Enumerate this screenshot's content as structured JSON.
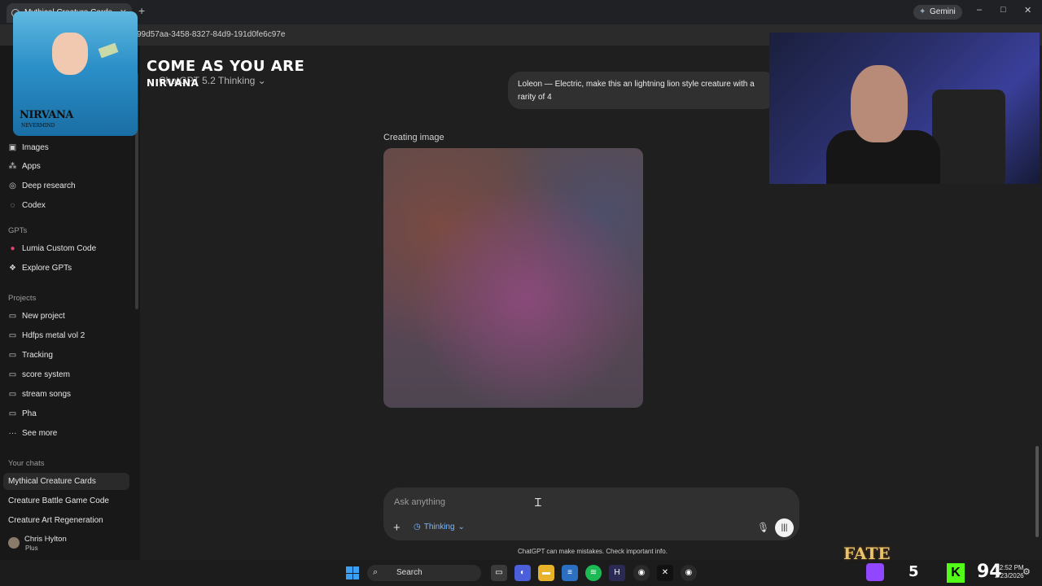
{
  "browser": {
    "tab_title": "Mythical Creature Cards",
    "new_tab": "+",
    "gemini_label": "Gemini",
    "url_fragment": "99d57aa-3458-8327-84d9-191d0fe6c97e",
    "window_controls": [
      "–",
      "□",
      "✕"
    ]
  },
  "sidebar": {
    "nav": [
      {
        "label": "Images",
        "icon": "images-icon",
        "glyph": "▣"
      },
      {
        "label": "Apps",
        "icon": "apps-icon",
        "glyph": "⁂"
      },
      {
        "label": "Deep research",
        "icon": "deep-research-icon",
        "glyph": "◎"
      },
      {
        "label": "Codex",
        "icon": "codex-icon",
        "glyph": "◌"
      }
    ],
    "gpts_heading": "GPTs",
    "gpts": [
      {
        "label": "Lumia Custom Code",
        "icon": "lumia-icon",
        "glyph": "●"
      },
      {
        "label": "Explore GPTs",
        "icon": "explore-icon",
        "glyph": "❖"
      }
    ],
    "projects_heading": "Projects",
    "projects": [
      {
        "label": "New project",
        "icon": "new-folder-icon",
        "glyph": "▭"
      },
      {
        "label": "Hdfps metal vol 2",
        "icon": "folder-icon",
        "glyph": "▭"
      },
      {
        "label": "Tracking",
        "icon": "folder-icon",
        "glyph": "▭"
      },
      {
        "label": "score system",
        "icon": "folder-icon",
        "glyph": "▭"
      },
      {
        "label": "stream songs",
        "icon": "folder-icon",
        "glyph": "▭"
      },
      {
        "label": "Pha",
        "icon": "folder-icon",
        "glyph": "▭"
      },
      {
        "label": "See more",
        "icon": "more-icon",
        "glyph": "···"
      }
    ],
    "chats_heading": "Your chats",
    "chats": [
      "Mythical Creature Cards",
      "Creature Battle Game Code",
      "Creature Art Regeneration"
    ],
    "user": {
      "name": "Chris Hylton",
      "plan": "Plus"
    }
  },
  "main": {
    "model_label": "ChatGPT 5.2 Thinking",
    "user_message": "Loleon — Electric, make this an lightning lion style creature with a rarity of 4",
    "creating_label": "Creating image",
    "composer": {
      "placeholder": "Ask anything",
      "mode": "Thinking"
    },
    "disclaimer": "ChatGPT can make mistakes. Check important info."
  },
  "overlay": {
    "song_title": "COME AS YOU ARE",
    "artist": "NIRVANA",
    "album_band": "NIRVANA",
    "album_subtitle": "NEVERMIND",
    "fate_logo": "FATE",
    "stat_five": "5",
    "big_number": "94"
  },
  "taskbar": {
    "search_label": "Search",
    "time": "12:52 PM",
    "date": "2/23/2026"
  },
  "colors": {
    "accent_blue": "#7ab8ff",
    "kick_green": "#53fc18",
    "twitch_purple": "#9146ff",
    "windows_blue": "#3aa0f3"
  }
}
